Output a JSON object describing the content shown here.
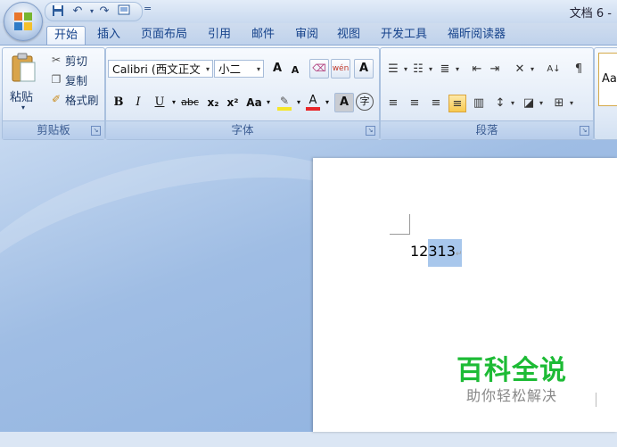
{
  "window": {
    "title": "文档 6 -"
  },
  "quick_access": {
    "icons": [
      "save-icon",
      "undo-icon",
      "redo-icon",
      "print-preview-icon"
    ],
    "more": "="
  },
  "tabs": [
    "开始",
    "插入",
    "页面布局",
    "引用",
    "邮件",
    "审阅",
    "视图",
    "开发工具",
    "福昕阅读器"
  ],
  "active_tab": "开始",
  "ribbon": {
    "clipboard": {
      "label": "剪贴板",
      "paste": "粘贴",
      "cut": "剪切",
      "copy": "复制",
      "format_painter": "格式刷"
    },
    "font": {
      "label": "字体",
      "font_name": "Calibri (西文正文",
      "font_size": "小二",
      "grow": "A",
      "shrink": "A",
      "bold": "B",
      "italic": "I",
      "underline": "U",
      "strike": "abc",
      "subscript": "x₂",
      "superscript": "x²",
      "change_case": "Aa",
      "highlight": "✎",
      "font_color": "A",
      "char_shading": "A",
      "enclose": "字",
      "phonetic": "wén",
      "char_border": "A"
    },
    "paragraph": {
      "label": "段落"
    },
    "styles": {
      "sample": "Aa"
    }
  },
  "document": {
    "text_plain": "12",
    "text_selected": "313",
    "paragraph_mark": "↵"
  },
  "watermark": {
    "main": "百科全说",
    "sub": "助你轻松解决"
  },
  "colors": {
    "accent": "#15428b",
    "highlight_bar": "#f5e62a",
    "font_color_bar": "#e8262a",
    "watermark_green": "#1dbb35",
    "selection": "#a8c7ec"
  }
}
